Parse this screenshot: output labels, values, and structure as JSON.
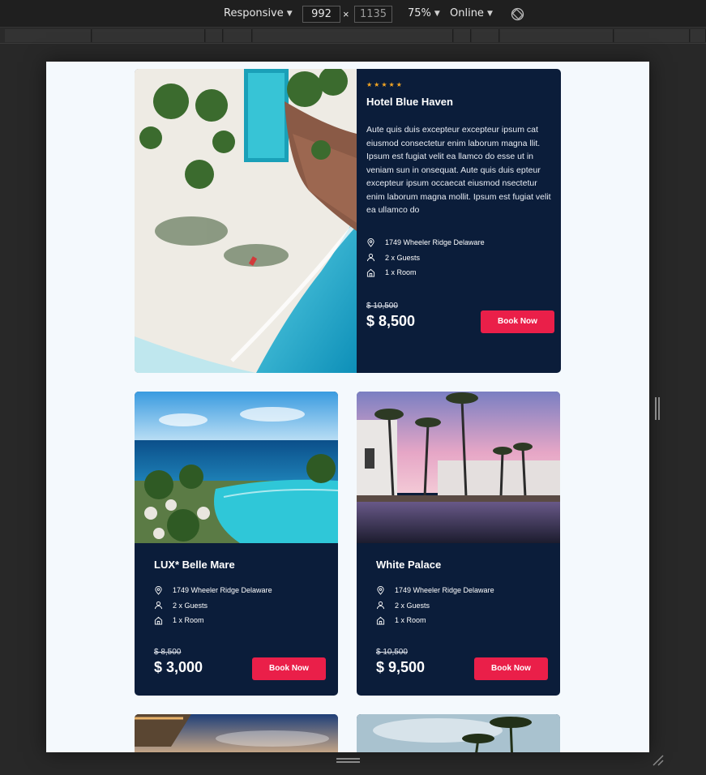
{
  "devtools": {
    "device": "Responsive",
    "width": "992",
    "height": "1135",
    "separator": "×",
    "zoom": "75%",
    "network": "Online"
  },
  "featured": {
    "rating_stars": "★★★★★",
    "title": "Hotel Blue Haven",
    "description": "Aute quis duis excepteur excepteur ipsum cat eiusmod consectetur enim laborum magna llit. Ipsum est fugiat velit ea llamco do esse ut in veniam sun in onsequat. Aute quis duis epteur excepteur ipsum occaecat eiusmod nsectetur enim laborum magna mollit. Ipsum est fugiat velit ea ullamco do",
    "address": "1749 Wheeler Ridge Delaware",
    "guests": "2 x Guests",
    "rooms": "1 x Room",
    "old_price": "$ 10,500",
    "price": "$ 8,500",
    "cta": "Book Now"
  },
  "hotels": [
    {
      "title": "LUX* Belle Mare",
      "address": "1749 Wheeler Ridge Delaware",
      "guests": "2 x Guests",
      "rooms": "1 x Room",
      "old_price": "$ 8,500",
      "price": "$ 3,000",
      "cta": "Book Now"
    },
    {
      "title": "White Palace",
      "address": "1749 Wheeler Ridge Delaware",
      "guests": "2 x Guests",
      "rooms": "1 x Room",
      "old_price": "$ 10,500",
      "price": "$ 9,500",
      "cta": "Book Now"
    }
  ],
  "colors": {
    "card_bg": "#0b1d3a",
    "accent": "#ea1f49",
    "star": "#f5a623",
    "page_bg": "#f4f9fd"
  },
  "icons": [
    "location-pin-icon",
    "user-icon",
    "home-icon",
    "rotate-icon"
  ]
}
